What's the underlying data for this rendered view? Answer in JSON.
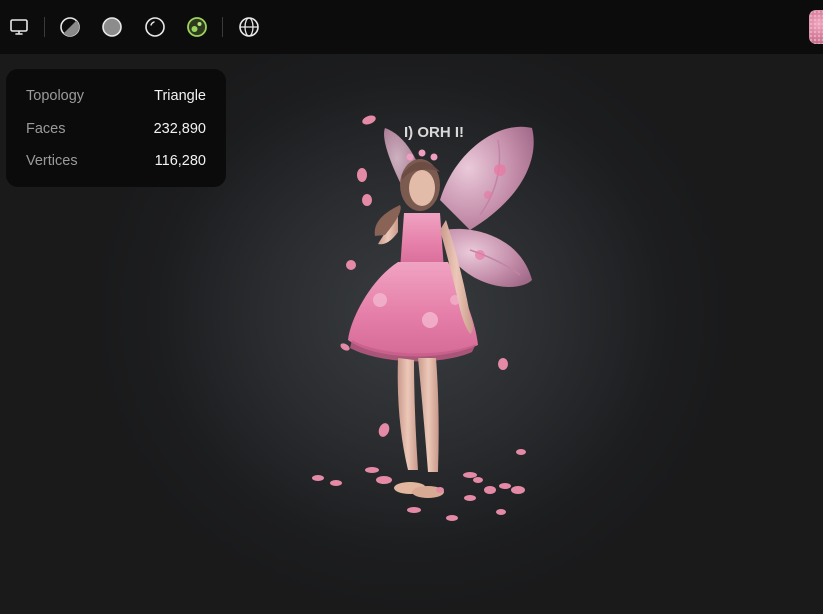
{
  "toolbar": {
    "buttons": [
      {
        "icon": "monitor-icon",
        "name": "display-mode-button"
      },
      {
        "icon": "half-shaded-sphere-icon",
        "name": "shading-toggle-button"
      },
      {
        "icon": "solid-sphere-icon",
        "name": "solid-view-button"
      },
      {
        "icon": "outline-sphere-icon",
        "name": "clay-view-button"
      },
      {
        "icon": "textured-sphere-icon",
        "name": "textured-view-button",
        "active_color": "#9bd45a"
      },
      {
        "icon": "globe-icon",
        "name": "environment-button"
      }
    ],
    "thumbnail": "model-thumbnail"
  },
  "info_panel": {
    "rows": [
      {
        "label": "Topology",
        "value": "Triangle"
      },
      {
        "label": "Faces",
        "value": "232,890"
      },
      {
        "label": "Vertices",
        "value": "116,280"
      }
    ]
  },
  "model": {
    "caption": "I) ORH I!",
    "colors": {
      "dress": "#e886ad",
      "wings": "#d9a4c2",
      "petals": "#e58aa6",
      "skin": "#e9c4b4"
    }
  }
}
